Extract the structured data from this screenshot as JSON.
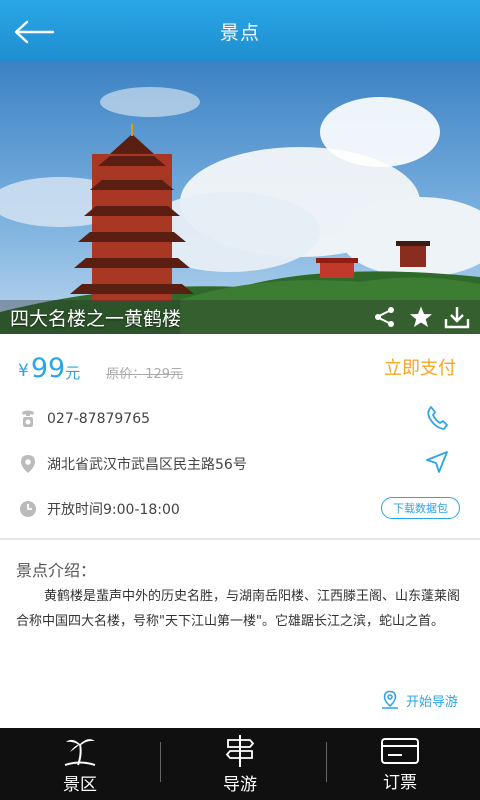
{
  "header": {
    "title": "景点",
    "back_icon": "back-arrow-icon"
  },
  "hero": {
    "title": "四大名楼之一黄鹤楼",
    "actions": [
      "share-icon",
      "star-icon",
      "download-icon"
    ]
  },
  "price": {
    "symbol": "¥",
    "value": "99",
    "unit": "元",
    "original": "原价：129元",
    "pay_label": "立即支付"
  },
  "info": {
    "phone": "027-87879765",
    "address": "湖北省武汉市武昌区民主路56号",
    "hours": "开放时间9:00-18:00",
    "download_label": "下载数据包"
  },
  "intro": {
    "title": "景点介绍：",
    "body": "黄鹤楼是蜚声中外的历史名胜，与湖南岳阳楼、江西滕王阁、山东蓬莱阁合称中国四大名楼，号称\"天下江山第一楼\"。它雄踞长江之滨，蛇山之首。",
    "guide_label": "开始导游"
  },
  "tabs": [
    {
      "label": "景区",
      "icon": "palm-tree-icon"
    },
    {
      "label": "导游",
      "icon": "signpost-icon"
    },
    {
      "label": "订票",
      "icon": "ticket-card-icon"
    }
  ],
  "colors": {
    "accent": "#2aa6e6",
    "pay": "#f5a623",
    "tabbar": "#101010"
  }
}
